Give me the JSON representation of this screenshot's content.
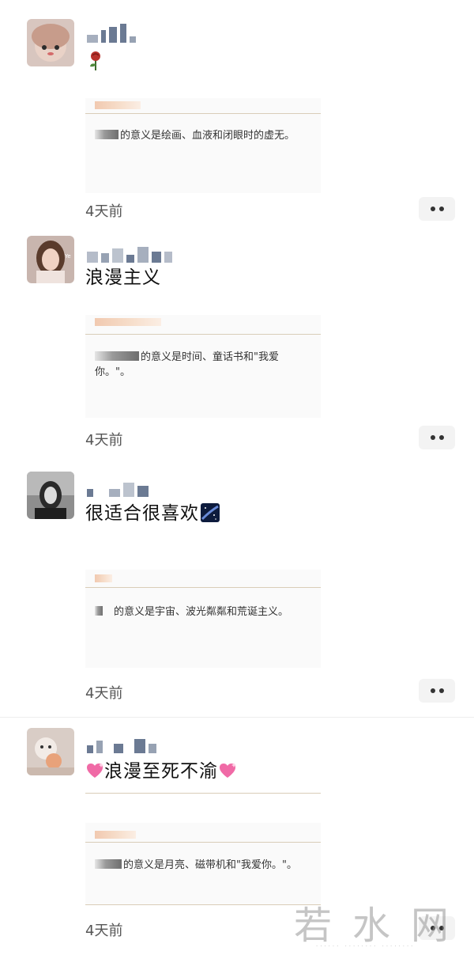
{
  "posts": [
    {
      "text": "",
      "quote_text": "的意义是绘画、血液和闭眼时的虚无。",
      "time": "4天前"
    },
    {
      "text": "浪漫主义",
      "quote_text": "的意义是时间、童话书和\"我爱你。\"。",
      "time": "4天前"
    },
    {
      "text": "很适合很喜欢",
      "quote_text": "的意义是宇宙、波光粼粼和荒诞主义。",
      "time": "4天前"
    },
    {
      "text": "浪漫至死不渝",
      "quote_text": "的意义是月亮、磁带机和\"我爱你。\"。",
      "time": "4天前"
    }
  ],
  "watermark": {
    "main": "若水网",
    "sub": "...... ........ ........"
  },
  "colors": {
    "background": "#ffffff",
    "divider": "#d9cdb8",
    "more_button_bg": "#f3f3f3",
    "mosaic_name": "#6b7a93"
  },
  "icons": {
    "more": "more-dots-icon",
    "rose": "rose-emoji-icon",
    "heart": "sparkling-heart-emoji-icon",
    "galaxy": "milky-way-emoji-icon"
  }
}
